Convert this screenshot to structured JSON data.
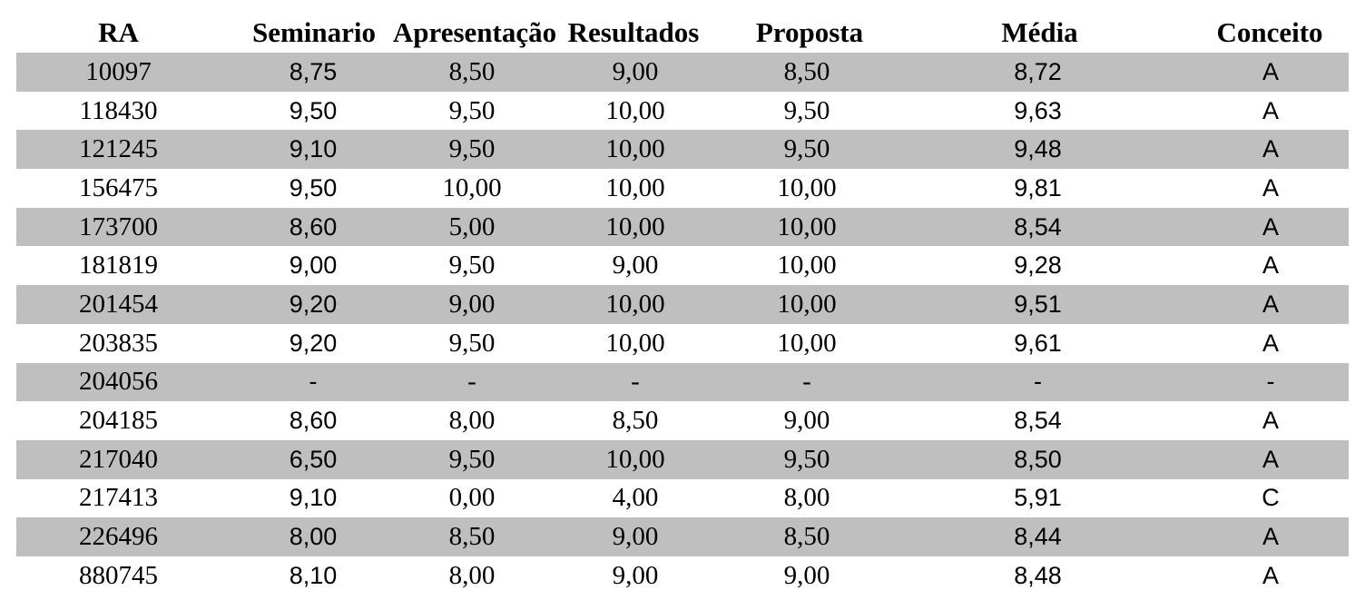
{
  "table": {
    "headers": {
      "ra": "RA",
      "seminario": "Seminario",
      "apresentacao": "Apresentação",
      "resultados": "Resultados",
      "proposta": "Proposta",
      "media": "Média",
      "conceito": "Conceito"
    },
    "rows": [
      {
        "ra": "10097",
        "seminario": "8,75",
        "apresentacao": "8,50",
        "resultados": "9,00",
        "proposta": "8,50",
        "media": "8,72",
        "conceito": "A"
      },
      {
        "ra": "118430",
        "seminario": "9,50",
        "apresentacao": "9,50",
        "resultados": "10,00",
        "proposta": "9,50",
        "media": "9,63",
        "conceito": "A"
      },
      {
        "ra": "121245",
        "seminario": "9,10",
        "apresentacao": "9,50",
        "resultados": "10,00",
        "proposta": "9,50",
        "media": "9,48",
        "conceito": "A"
      },
      {
        "ra": "156475",
        "seminario": "9,50",
        "apresentacao": "10,00",
        "resultados": "10,00",
        "proposta": "10,00",
        "media": "9,81",
        "conceito": "A"
      },
      {
        "ra": "173700",
        "seminario": "8,60",
        "apresentacao": "5,00",
        "resultados": "10,00",
        "proposta": "10,00",
        "media": "8,54",
        "conceito": "A"
      },
      {
        "ra": "181819",
        "seminario": "9,00",
        "apresentacao": "9,50",
        "resultados": "9,00",
        "proposta": "10,00",
        "media": "9,28",
        "conceito": "A"
      },
      {
        "ra": "201454",
        "seminario": "9,20",
        "apresentacao": "9,00",
        "resultados": "10,00",
        "proposta": "10,00",
        "media": "9,51",
        "conceito": "A"
      },
      {
        "ra": "203835",
        "seminario": "9,20",
        "apresentacao": "9,50",
        "resultados": "10,00",
        "proposta": "10,00",
        "media": "9,61",
        "conceito": "A"
      },
      {
        "ra": "204056",
        "seminario": "-",
        "apresentacao": "-",
        "resultados": "-",
        "proposta": "-",
        "media": "-",
        "conceito": "-"
      },
      {
        "ra": "204185",
        "seminario": "8,60",
        "apresentacao": "8,00",
        "resultados": "8,50",
        "proposta": "9,00",
        "media": "8,54",
        "conceito": "A"
      },
      {
        "ra": "217040",
        "seminario": "6,50",
        "apresentacao": "9,50",
        "resultados": "10,00",
        "proposta": "9,50",
        "media": "8,50",
        "conceito": "A"
      },
      {
        "ra": "217413",
        "seminario": "9,10",
        "apresentacao": "0,00",
        "resultados": "4,00",
        "proposta": "8,00",
        "media": "5,91",
        "conceito": "C"
      },
      {
        "ra": "226496",
        "seminario": "8,00",
        "apresentacao": "8,50",
        "resultados": "9,00",
        "proposta": "8,50",
        "media": "8,44",
        "conceito": "A"
      },
      {
        "ra": "880745",
        "seminario": "8,10",
        "apresentacao": "8,00",
        "resultados": "9,00",
        "proposta": "9,00",
        "media": "8,48",
        "conceito": "A"
      }
    ],
    "shaded_row_color": "#bfbfbf"
  }
}
